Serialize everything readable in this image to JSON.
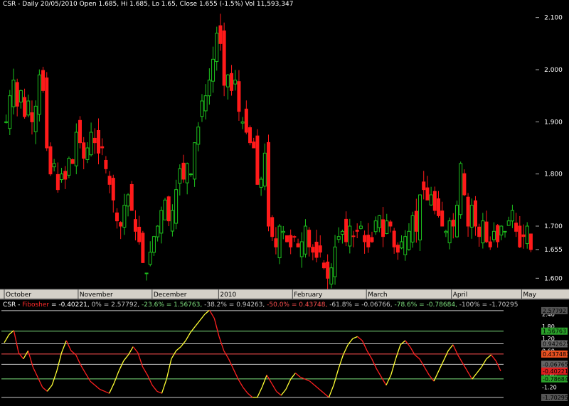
{
  "header": {
    "price_title": "CSR - Daily 20/05/2010 Open 1.685, Hi 1.685, Lo 1.65, Close 1.655 (-1.5%) Vol 11,593,347",
    "ind_prefix": "CSR - ",
    "ind_name": "Fibosher",
    "ind_rest": " = -0.40221, ",
    "levels_text": [
      {
        "text": "0% = 2.57792, ",
        "color": "#c8c8c8"
      },
      {
        "text": "-23.6% = 1.56763, ",
        "color": "#7ee07e"
      },
      {
        "text": "-38.2% = 0.94263, ",
        "color": "#c8c8c8"
      },
      {
        "text": "-50.0% = 0.43748, ",
        "color": "#ff5050"
      },
      {
        "text": "-61.8% = -0.06766, ",
        "color": "#c8c8c8"
      },
      {
        "text": "-78.6% = -0.78684, ",
        "color": "#7ee07e"
      },
      {
        "text": "-100% = -1.70295",
        "color": "#c8c8c8"
      }
    ]
  },
  "colors": {
    "up": "#1dc21d",
    "down": "#ff1a1a",
    "grid_price": "#2a2a2a",
    "axis_bg": "#d4d0c8",
    "fib": "#ff2020",
    "fib_up": "#ffff33"
  },
  "chart_data": [
    {
      "type": "candlestick",
      "title": "CSR - Daily",
      "ylim": [
        1.58,
        2.12
      ],
      "y_ticks": [
        "2.100",
        "2.000",
        "1.900",
        "1.800",
        "1.700",
        "1.655",
        "1.600"
      ],
      "y_tick_values": [
        2.1,
        2.0,
        1.9,
        1.8,
        1.7,
        1.655,
        1.6
      ],
      "x_labels": [
        {
          "label": "October",
          "index": 0
        },
        {
          "label": "November",
          "index": 20
        },
        {
          "label": "December",
          "index": 40
        },
        {
          "label": "2010",
          "index": 58
        },
        {
          "label": "February",
          "index": 78
        },
        {
          "label": "March",
          "index": 98
        },
        {
          "label": "April",
          "index": 121
        },
        {
          "label": "May",
          "index": 140
        }
      ],
      "closes": [
        1.9,
        1.95,
        1.98,
        1.93,
        1.96,
        1.91,
        1.94,
        1.9,
        1.93,
        1.99,
        1.96,
        1.85,
        1.8,
        1.82,
        1.77,
        1.8,
        1.79,
        1.83,
        1.82,
        1.88,
        1.86,
        1.83,
        1.85,
        1.88,
        1.86,
        1.84,
        1.85,
        1.81,
        1.78,
        1.75,
        1.71,
        1.7,
        1.74,
        1.76,
        1.73,
        1.69,
        1.67,
        1.63,
        1.61,
        1.65,
        1.68,
        1.7,
        1.73,
        1.75,
        1.71,
        1.73,
        1.77,
        1.81,
        1.79,
        1.82,
        1.8,
        1.86,
        1.89,
        1.94,
        1.95,
        1.98,
        2.02,
        2.07,
        2.05,
        1.97,
        1.99,
        1.96,
        1.98,
        1.92,
        1.9,
        1.88,
        1.86,
        1.85,
        1.78,
        1.79,
        1.84,
        1.7,
        1.68,
        1.66,
        1.7,
        1.69,
        1.67,
        1.66,
        1.68,
        1.66,
        1.67,
        1.7,
        1.66,
        1.65,
        1.64,
        1.65,
        1.62,
        1.6,
        1.62,
        1.66,
        1.68,
        1.69,
        1.67,
        1.7,
        1.68,
        1.69,
        1.7,
        1.67,
        1.66,
        1.67,
        1.71,
        1.72,
        1.68,
        1.71,
        1.7,
        1.66,
        1.65,
        1.67,
        1.68,
        1.69,
        1.72,
        1.69,
        1.76,
        1.77,
        1.75,
        1.76,
        1.73,
        1.72,
        1.7,
        1.69,
        1.71,
        1.7,
        1.74,
        1.82,
        1.76,
        1.7,
        1.74,
        1.7,
        1.68,
        1.71,
        1.67,
        1.66,
        1.69,
        1.67,
        1.7,
        1.69,
        1.71,
        1.73,
        1.69,
        1.66,
        1.68,
        1.7,
        1.655
      ],
      "highs_above_close": "approx",
      "last": {
        "open": 1.685,
        "high": 1.685,
        "low": 1.65,
        "close": 1.655
      }
    },
    {
      "type": "line",
      "title": "Fibosher",
      "ylim": [
        -1.95,
        2.75
      ],
      "y_ticks": [
        "2.40",
        "1.80",
        "1.20",
        "0.60",
        "-0.60",
        "-1.20"
      ],
      "y_tick_values": [
        2.4,
        1.8,
        1.2,
        0.6,
        -0.6,
        -1.2
      ],
      "levels": [
        {
          "name": "0%",
          "value": 2.57792,
          "label": "2.57792",
          "color": "#c8c8c8",
          "bg": "#555555"
        },
        {
          "name": "-23.6%",
          "value": 1.56763,
          "label": "1.56763",
          "color": "#7ee07e",
          "bg": "#2aa02a"
        },
        {
          "name": "-38.2%",
          "value": 0.94263,
          "label": "0.942625",
          "color": "#c8c8c8",
          "bg": "#666666"
        },
        {
          "name": "-50.0%",
          "value": 0.43748,
          "label": "0.437483",
          "color": "#ff5050",
          "bg": "#e85020"
        },
        {
          "name": "-61.8%",
          "value": -0.06766,
          "label": "-0.067658",
          "color": "#c8c8c8",
          "bg": "#666666"
        },
        {
          "name": "current",
          "value": -0.40221,
          "label": "-0.40221",
          "color": "#ff3030",
          "bg": "#e02020"
        },
        {
          "name": "-78.6%",
          "value": -0.78684,
          "label": "-0.786844",
          "color": "#7ee07e",
          "bg": "#2aa02a"
        },
        {
          "name": "-100%",
          "value": -1.70295,
          "label": "-1.70295",
          "color": "#c8c8c8",
          "bg": "#555555"
        }
      ],
      "values": [
        1.0,
        1.4,
        1.6,
        0.5,
        0.2,
        0.6,
        -0.2,
        -0.7,
        -1.2,
        -1.4,
        -1.1,
        -0.4,
        0.5,
        1.1,
        0.6,
        0.4,
        -0.1,
        -0.5,
        -0.9,
        -1.1,
        -1.3,
        -1.4,
        -1.5,
        -1.0,
        -0.4,
        0.1,
        0.4,
        0.8,
        0.5,
        -0.2,
        -0.6,
        -1.1,
        -1.4,
        -1.5,
        -0.8,
        0.2,
        0.6,
        0.8,
        1.1,
        1.5,
        1.8,
        2.1,
        2.4,
        2.6,
        2.2,
        1.3,
        0.6,
        0.2,
        -0.3,
        -0.8,
        -1.2,
        -1.5,
        -1.7,
        -1.7,
        -1.2,
        -0.6,
        -1.0,
        -1.4,
        -1.6,
        -1.3,
        -0.8,
        -0.5,
        -0.7,
        -0.8,
        -0.9,
        -1.1,
        -1.3,
        -1.5,
        -1.7,
        -1.1,
        -0.3,
        0.4,
        0.9,
        1.2,
        1.3,
        1.1,
        0.6,
        0.2,
        -0.3,
        -0.7,
        -1.1,
        -0.6,
        0.2,
        0.9,
        1.1,
        0.8,
        0.4,
        0.2,
        -0.2,
        -0.6,
        -0.9,
        -0.4,
        0.1,
        0.6,
        0.9,
        0.4,
        0.0,
        -0.4,
        -0.8,
        -0.5,
        -0.2,
        0.2,
        0.4,
        0.1,
        -0.4
      ],
      "down_color": "#ff2020",
      "up_color": "#ffff33"
    }
  ]
}
